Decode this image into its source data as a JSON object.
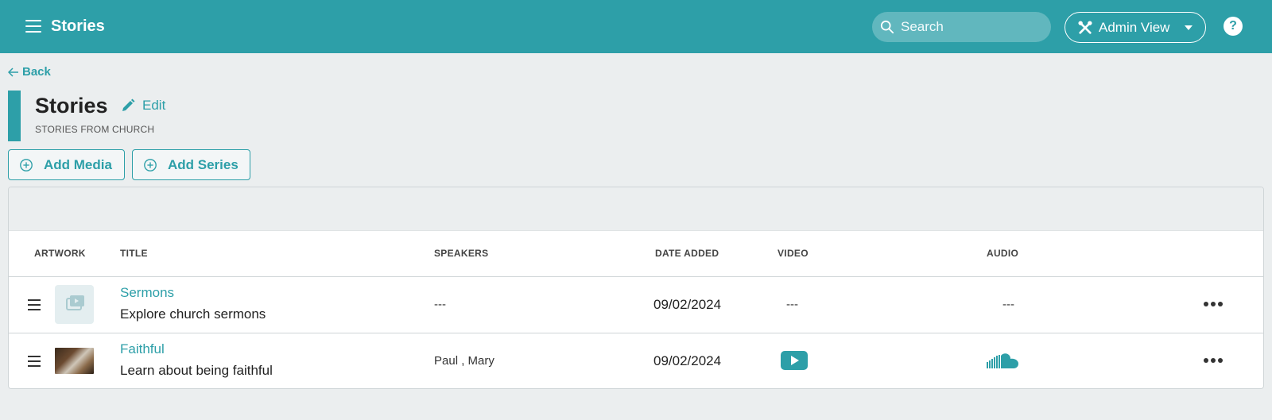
{
  "header": {
    "app_title": "Stories",
    "search_placeholder": "Search",
    "admin_label": "Admin View",
    "help_label": "?"
  },
  "nav": {
    "back_label": "Back"
  },
  "page": {
    "title": "Stories",
    "edit_label": "Edit",
    "subtitle": "STORIES FROM CHURCH"
  },
  "actions": {
    "add_media": "Add Media",
    "add_series": "Add Series"
  },
  "table": {
    "columns": [
      "ARTWORK",
      "TITLE",
      "SPEAKERS",
      "DATE ADDED",
      "VIDEO",
      "AUDIO"
    ],
    "rows": [
      {
        "title": "Sermons",
        "description": "Explore church sermons",
        "speakers": "---",
        "date_added": "09/02/2024",
        "video": "---",
        "audio": "---",
        "artwork": "series-placeholder-icon"
      },
      {
        "title": "Faithful",
        "description": "Learn about being faithful",
        "speakers": "Paul , Mary",
        "date_added": "09/02/2024",
        "video": "play-icon",
        "audio": "soundcloud-icon",
        "artwork": "photo-thumbnail"
      }
    ]
  },
  "colors": {
    "accent": "#2d9fa8",
    "background": "#ebeeef"
  }
}
